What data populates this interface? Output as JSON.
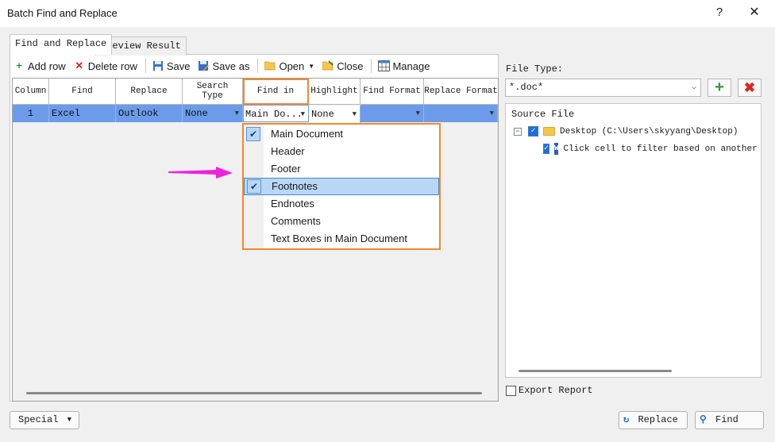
{
  "window": {
    "title": "Batch Find and Replace",
    "help": "?",
    "close": "✕"
  },
  "tabs": [
    {
      "label": "Find and Replace",
      "active": true
    },
    {
      "label": "Preview Result",
      "active": false
    }
  ],
  "toolbar": {
    "add_row": "Add row",
    "delete_row": "Delete row",
    "save": "Save",
    "save_as": "Save as",
    "open": "Open",
    "close": "Close",
    "manage": "Manage"
  },
  "grid": {
    "columns": [
      "Column",
      "Find",
      "Replace",
      "Search Type",
      "Find in",
      "Highlight",
      "Find Format",
      "Replace Format"
    ],
    "rows": [
      {
        "column": "1",
        "find": "Excel",
        "replace": "Outlook",
        "search_type": "None",
        "find_in": "Main Do...",
        "highlight": "None",
        "find_format": "",
        "replace_format": ""
      }
    ]
  },
  "find_in_dropdown": {
    "items": [
      {
        "label": "Main Document",
        "checked": true,
        "selected": false
      },
      {
        "label": "Header",
        "checked": false,
        "selected": false
      },
      {
        "label": "Footer",
        "checked": false,
        "selected": false
      },
      {
        "label": "Footnotes",
        "checked": true,
        "selected": true
      },
      {
        "label": "Endnotes",
        "checked": false,
        "selected": false
      },
      {
        "label": "Comments",
        "checked": false,
        "selected": false
      },
      {
        "label": "Text Boxes in Main Document",
        "checked": false,
        "selected": false
      }
    ]
  },
  "right_panel": {
    "file_type_label": "File Type:",
    "file_type_value": "*.doc*",
    "source_file_label": "Source File",
    "tree": [
      {
        "label": "Desktop (C:\\Users\\skyyang\\Desktop)",
        "checked": true,
        "type": "folder"
      },
      {
        "label": "Click cell to filter based on another w",
        "checked": true,
        "type": "word-doc"
      }
    ],
    "export_report_label": "Export Report",
    "export_report_checked": false
  },
  "footer": {
    "special": "Special",
    "replace": "Replace",
    "find": "Find"
  },
  "colors": {
    "row_selected": "#6c9bea",
    "highlight_border": "#f08a2c",
    "annotation_arrow": "#ee22dd",
    "add_green": "#2e9c3f",
    "delete_red": "#d9291c"
  }
}
